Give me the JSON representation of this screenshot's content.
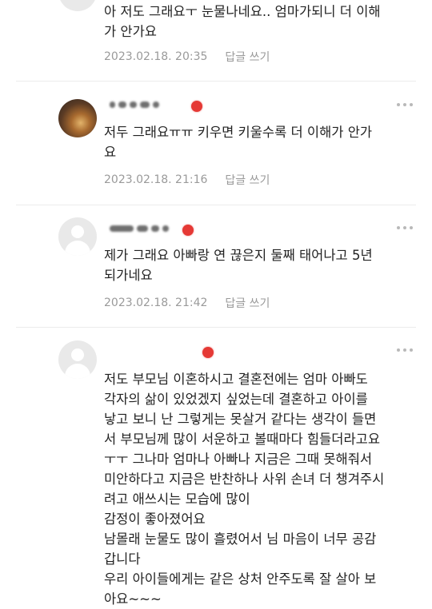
{
  "comments": [
    {
      "lines": [
        "아 저도 그래요ㅜ 눈물나네요.. 엄마가되니 더 이해",
        "가 안가요"
      ],
      "date": "2023.02.18. 20:35",
      "reply": "답글 쓰기"
    },
    {
      "lines": [
        "저두 그래요ㅠㅠ 키우면 키울수록 더 이해가 안가",
        "요"
      ],
      "date": "2023.02.18. 21:16",
      "reply": "답글 쓰기"
    },
    {
      "lines": [
        "제가 그래요 아빠랑 연 끊은지 둘째 태어나고 5년",
        "되가네요"
      ],
      "date": "2023.02.18. 21:42",
      "reply": "답글 쓰기"
    },
    {
      "lines": [
        "저도 부모님 이혼하시고 결혼전에는 엄마 아빠도",
        "각자의 삶이 있었겠지 싶었는데 결혼하고 아이를",
        "낳고 보니 난 그렇게는 못살거 같다는 생각이 들면",
        "서 부모님께 많이 서운하고 볼때마다 힘들더라고요",
        "ㅜㅜ 그나마 엄마나 아빠나 지금은 그때 못해줘서",
        "미안하다고 지금은 반찬하나 사위 손녀 더 챙겨주시",
        "려고 애쓰시는 모습에 많이",
        "감정이 좋아졌어요",
        "남몰래 눈물도 많이 흘렸어서 님 마음이 너무 공감",
        "갑니다",
        "우리 아이들에게는 같은 상처 안주도록 잘 살아 보",
        "아요~~~"
      ]
    }
  ],
  "icons": {
    "more": "more-horizontal-icon",
    "badge": "red-badge-icon"
  },
  "colors": {
    "text": "#222222",
    "meta": "#9a9a9a",
    "badge": "#e53935",
    "divider": "#ececec"
  }
}
